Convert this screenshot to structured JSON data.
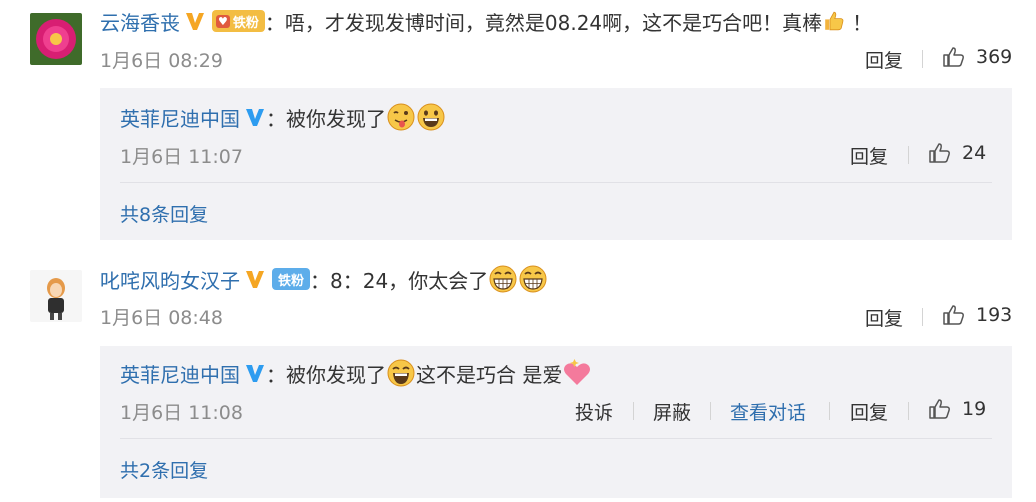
{
  "comments": [
    {
      "username": "云海香丧",
      "fan_badge": "铁粉",
      "text": "：唔，才发现发博时间，竟然是08.24啊，这不是巧合吧！真棒",
      "text_tail": "！",
      "time": "1月6日 08:29",
      "reply_label": "回复",
      "likes": "369",
      "replies": [
        {
          "username": "英菲尼迪中国",
          "text": "：被你发现了",
          "time": "1月6日 11:07",
          "reply_label": "回复",
          "likes": "24"
        }
      ],
      "more_replies": "共8条回复"
    },
    {
      "username": "叱咤风昀女汉子",
      "fan_badge": "铁粉",
      "text": "：8：24，你太会了",
      "time": "1月6日 08:48",
      "reply_label": "回复",
      "likes": "193",
      "replies": [
        {
          "username": "英菲尼迪中国",
          "text": "：被你发现了",
          "text_mid": "这不是巧合 是爱",
          "time": "1月6日 11:08",
          "report_label": "投诉",
          "block_label": "屏蔽",
          "view_dialog_label": "查看对话",
          "reply_label": "回复",
          "likes": "19"
        }
      ],
      "more_replies": "共2条回复"
    }
  ],
  "colors": {
    "link": "#2f6fae",
    "verified": "#f5a623",
    "verified_blue": "#2d9cf0",
    "fan_gold": "#f3bd43",
    "fan_blue": "#5dadea",
    "reply_bg": "#f2f2f5"
  }
}
